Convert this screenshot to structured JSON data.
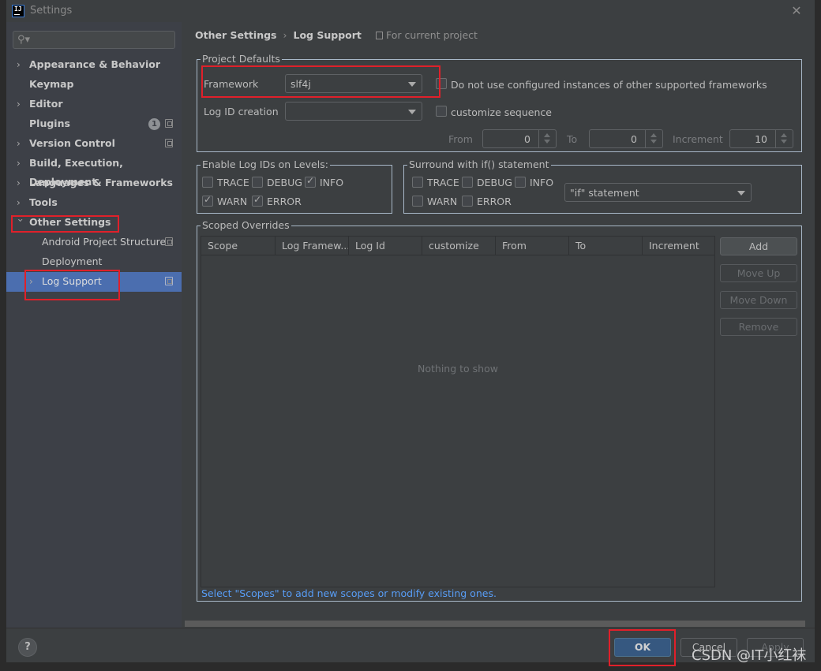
{
  "window": {
    "title": "Settings",
    "app_icon": "intellij-logo-icon",
    "close_icon": "close-icon"
  },
  "sidebar": {
    "search": {
      "placeholder": "",
      "icon": "search-icon"
    },
    "items": [
      {
        "label": "Appearance & Behavior",
        "expandable": true,
        "expanded": false
      },
      {
        "label": "Keymap",
        "expandable": false
      },
      {
        "label": "Editor",
        "expandable": true,
        "expanded": false
      },
      {
        "label": "Plugins",
        "expandable": false,
        "badge": "1",
        "project_icon": true
      },
      {
        "label": "Version Control",
        "expandable": true,
        "expanded": false,
        "project_icon": true
      },
      {
        "label": "Build, Execution, Deployment",
        "expandable": true,
        "expanded": false
      },
      {
        "label": "Languages & Frameworks",
        "expandable": true,
        "expanded": false
      },
      {
        "label": "Tools",
        "expandable": true,
        "expanded": false
      },
      {
        "label": "Other Settings",
        "expandable": true,
        "expanded": true
      },
      {
        "label": "Android Project Structure",
        "child": true,
        "project_icon": true
      },
      {
        "label": "Deployment",
        "child": true
      },
      {
        "label": "Log Support",
        "child": true,
        "expandable": true,
        "selected": true,
        "project_icon": true
      }
    ]
  },
  "breadcrumb": {
    "parent": "Other Settings",
    "separator": "›",
    "current": "Log Support",
    "scope_note": "For current project"
  },
  "project_defaults": {
    "title": "Project Defaults",
    "framework_label": "Framework",
    "framework_value": "slf4j",
    "do_not_use_label": "Do not use configured instances of other supported frameworks",
    "do_not_use_checked": false,
    "log_id_label": "Log ID creation",
    "log_id_value": "",
    "customize_label": "customize sequence",
    "customize_checked": false,
    "from_label": "From",
    "from_value": "0",
    "to_label": "To",
    "to_value": "0",
    "increment_label": "Increment",
    "increment_value": "10"
  },
  "enable_levels": {
    "title": "Enable Log IDs on Levels:",
    "levels": [
      {
        "label": "TRACE",
        "checked": false
      },
      {
        "label": "DEBUG",
        "checked": false
      },
      {
        "label": "INFO",
        "checked": true
      },
      {
        "label": "WARN",
        "checked": true
      },
      {
        "label": "ERROR",
        "checked": true
      }
    ]
  },
  "surround_if": {
    "title": "Surround with if() statement",
    "levels": [
      {
        "label": "TRACE",
        "checked": false
      },
      {
        "label": "DEBUG",
        "checked": false
      },
      {
        "label": "INFO",
        "checked": false
      },
      {
        "label": "WARN",
        "checked": false
      },
      {
        "label": "ERROR",
        "checked": false
      }
    ],
    "statement_value": "\"if\" statement"
  },
  "scoped_overrides": {
    "title": "Scoped Overrides",
    "columns": [
      "Scope",
      "Log Framew...",
      "Log Id",
      "customize",
      "From",
      "To",
      "Increment"
    ],
    "rows": [],
    "empty_text": "Nothing to show",
    "buttons": {
      "add": "Add",
      "move_up": "Move Up",
      "move_down": "Move Down",
      "remove": "Remove"
    },
    "hint": "Select \"Scopes\" to add new scopes or modify existing ones."
  },
  "footer": {
    "help": "?",
    "ok": "OK",
    "cancel": "Cancel",
    "apply": "Apply"
  },
  "watermark": "CSDN @IT小红袜",
  "colors": {
    "selection": "#4b6eaf",
    "ok_button": "#365880",
    "hint_link": "#589df6",
    "annotation_red": "#e0202a"
  }
}
